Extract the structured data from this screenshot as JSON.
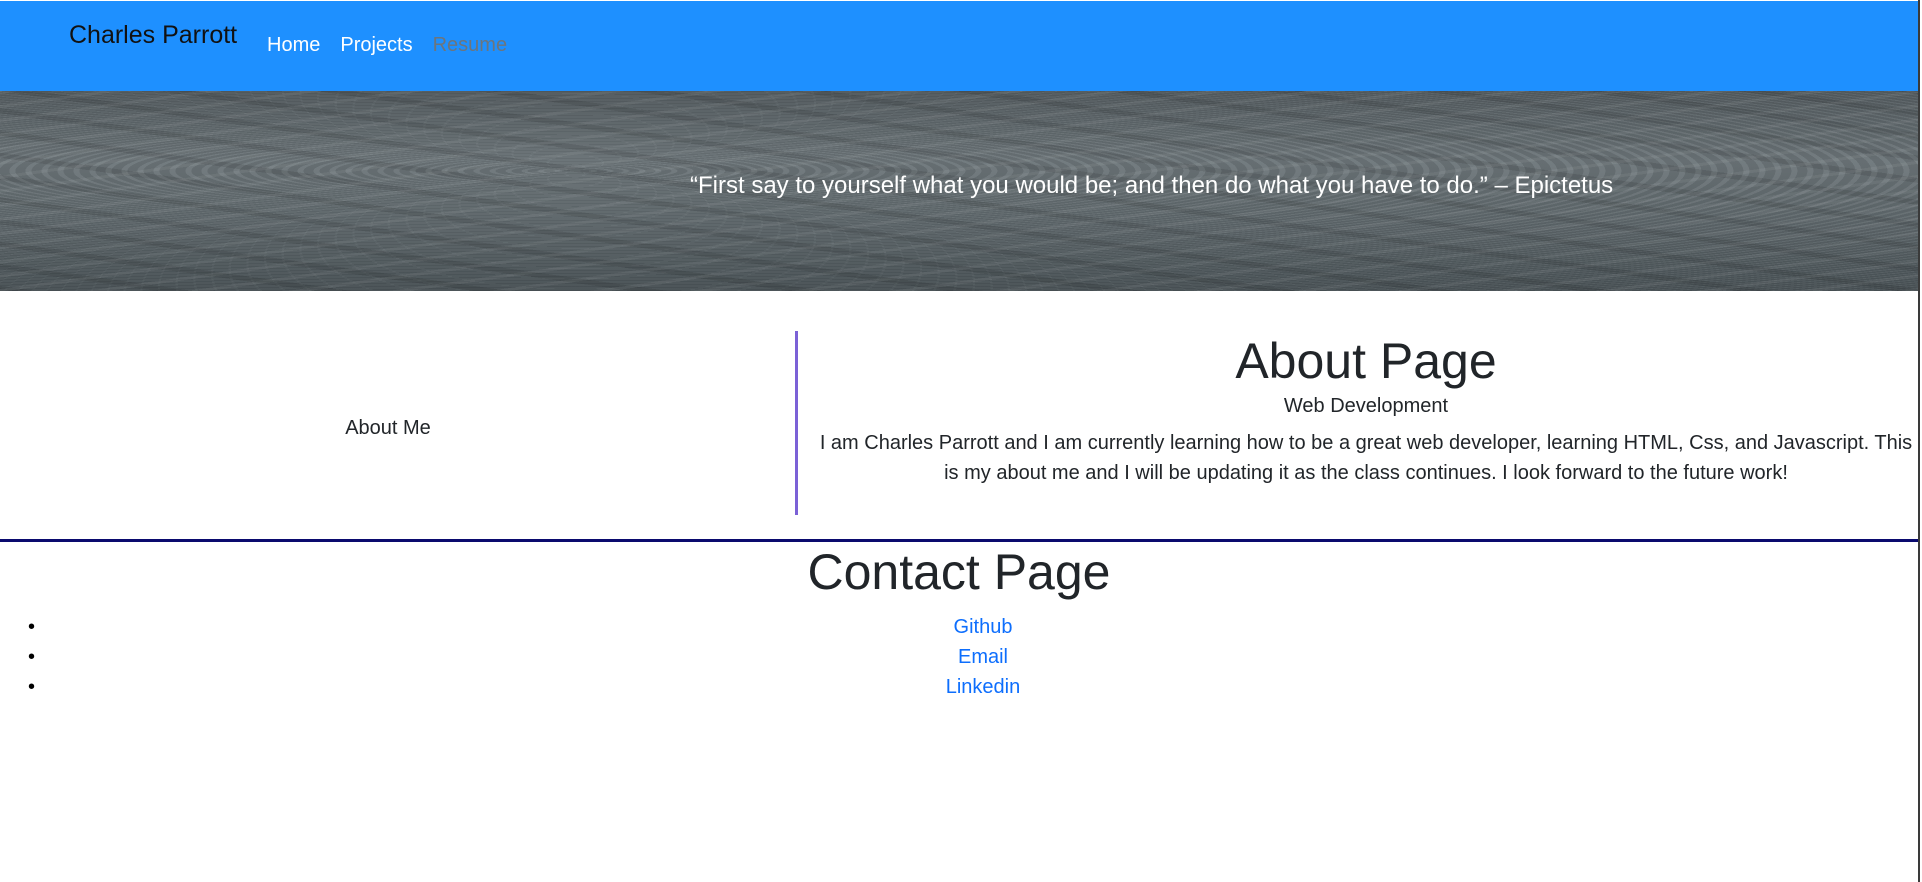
{
  "navbar": {
    "brand": "Charles Parrott",
    "links": [
      {
        "label": "Home"
      },
      {
        "label": "Projects"
      },
      {
        "label": "Resume"
      }
    ]
  },
  "hero": {
    "quote": "“First say to yourself what you would be; and then do what you have to do.” – Epictetus"
  },
  "about": {
    "side_label": "About Me",
    "title": "About Page",
    "subtitle": "Web Development",
    "text": "I am Charles Parrott and I am currently learning how to be a great web developer, learning HTML, Css, and Javascript. This is my about me and I will be updating it as the class continues. I look forward to the future work!"
  },
  "contact": {
    "title": "Contact Page",
    "links": [
      {
        "label": "Github",
        "bullet": "•"
      },
      {
        "label": "Email",
        "bullet": "•"
      },
      {
        "label": "Linkedin",
        "bullet": "•"
      }
    ]
  },
  "colors": {
    "navbar_bg": "#1e90ff",
    "link": "#0d6efd",
    "disabled_link": "#6c757d",
    "vertical_divider": "#7b61d6",
    "horizontal_divider": "#0a0a6e"
  }
}
